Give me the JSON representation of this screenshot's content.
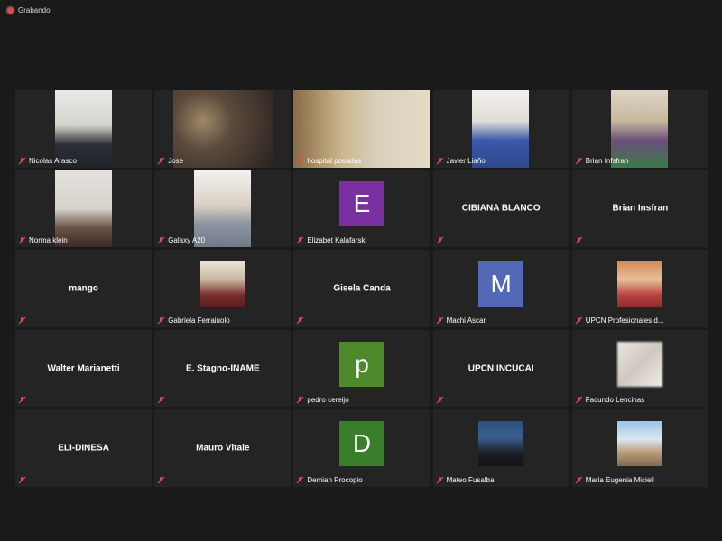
{
  "recording": {
    "label": "Grabando"
  },
  "colors": {
    "purple_avatar": "#7a2fa3",
    "blue_avatar": "#5468b8",
    "green_avatar": "#4c8a2b",
    "green_avatar_dark": "#3a7d2a",
    "muted_red": "#e04a4a"
  },
  "participants": [
    {
      "name": "Nicolas Arasco",
      "mode": "video"
    },
    {
      "name": "Jose",
      "mode": "video"
    },
    {
      "name": "hospital posadas",
      "mode": "video"
    },
    {
      "name": "Javier Liaño",
      "mode": "video"
    },
    {
      "name": "Brian Infsfran",
      "mode": "video"
    },
    {
      "name": "Norma klein",
      "mode": "video"
    },
    {
      "name": "Galaxy A20",
      "mode": "video"
    },
    {
      "name": "Elizabet Kalafarski",
      "mode": "letter",
      "letter": "E"
    },
    {
      "name": "CIBIANA BLANCO",
      "mode": "name"
    },
    {
      "name": "Brian Insfran",
      "mode": "name"
    },
    {
      "name": "mango",
      "mode": "name"
    },
    {
      "name": "Gabriela Ferraiuolo",
      "mode": "photo"
    },
    {
      "name": "Gisela Canda",
      "mode": "name"
    },
    {
      "name": "Machi Ascar",
      "mode": "letter",
      "letter": "M"
    },
    {
      "name": "UPCN Profesionales d...",
      "mode": "photo"
    },
    {
      "name": "Walter Marianetti",
      "mode": "name"
    },
    {
      "name": "E. Stagno-INAME",
      "mode": "name"
    },
    {
      "name": "pedro cereijo",
      "mode": "letter",
      "letter": "p"
    },
    {
      "name": "UPCN INCUCAI",
      "mode": "name"
    },
    {
      "name": "Facundo Lencinas",
      "mode": "photo"
    },
    {
      "name": "ELI-DINESA",
      "mode": "name"
    },
    {
      "name": "Mauro Vitale",
      "mode": "name"
    },
    {
      "name": "Demian Procopio",
      "mode": "letter",
      "letter": "D"
    },
    {
      "name": "Mateo Fusalba",
      "mode": "photo"
    },
    {
      "name": "Maria Eugenia Micieli",
      "mode": "photo"
    }
  ]
}
